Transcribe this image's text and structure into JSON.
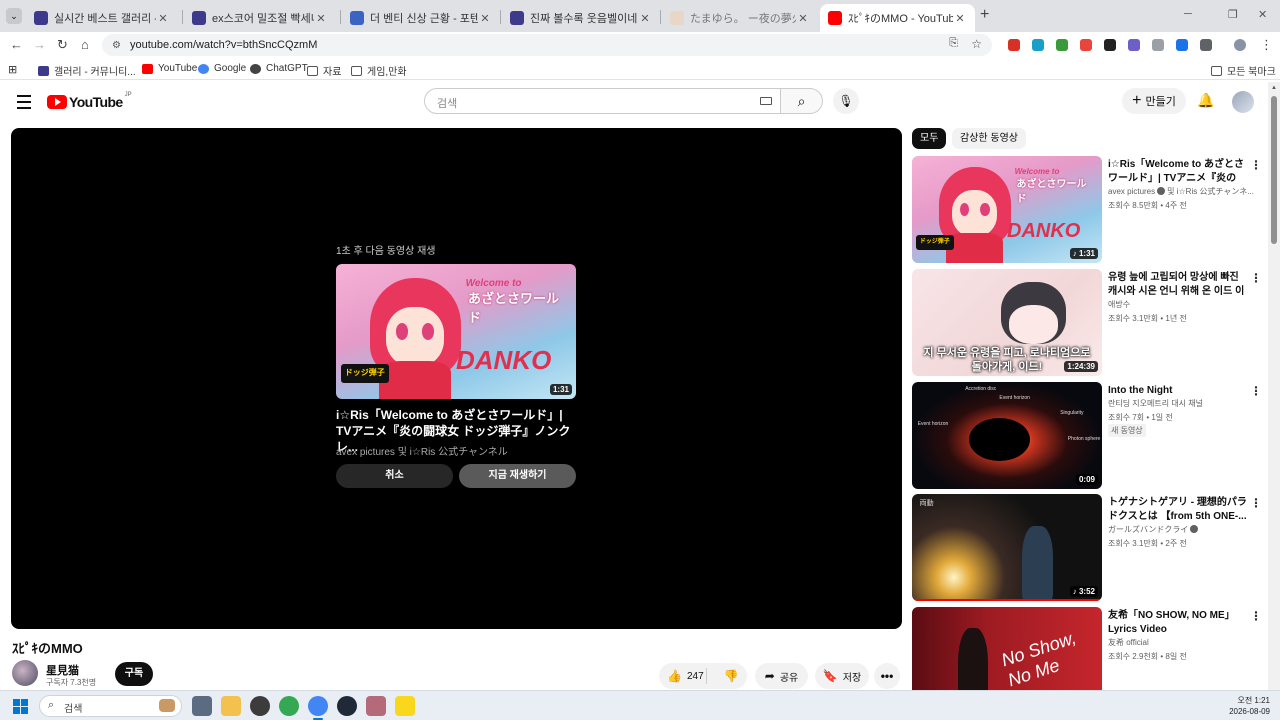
{
  "browser": {
    "tabs": [
      {
        "title": "실시간 베스트 갤러리 - 커뮤니",
        "color": "#3d3a8c"
      },
      {
        "title": "ex스코어 밀조절 빡세네 - 헤븐",
        "color": "#3d3a8c"
      },
      {
        "title": "더 벤티 신상 근황 - 포텐 터짐",
        "color": "#3a63c4"
      },
      {
        "title": "진짜 볼수록 웃음벨이네ㅋㅋㅋ",
        "color": "#3d3a8c"
      },
      {
        "title": "たまゆら。 ー夜の夢火 | スタジ",
        "color": "#e8d6c6"
      },
      {
        "title": "ｽﾋﾟｷのMMO - YouTube",
        "color": "#ff0000",
        "active": true
      }
    ],
    "url": "youtube.com/watch?v=bthSncCQzmM",
    "bookmarks": [
      {
        "label": "갤러리 - 커뮤니티...",
        "icon": "community-icon",
        "color": "#3d3a8c"
      },
      {
        "label": "YouTube",
        "icon": "youtube-icon",
        "color": "#ff0000"
      },
      {
        "label": "Google",
        "icon": "google-icon",
        "color": "#4285f4"
      },
      {
        "label": "ChatGPT",
        "icon": "chatgpt-icon",
        "color": "#444444"
      },
      {
        "label": "자료",
        "icon": "folder-icon",
        "color": "#555555"
      },
      {
        "label": "게임,만화",
        "icon": "folder-icon",
        "color": "#555555"
      }
    ],
    "all_bookmarks": "모든 북마크"
  },
  "youtube": {
    "logo_text": "YouTube",
    "region": "JP",
    "search_placeholder": "검색",
    "create_label": "만들기",
    "player": {
      "upnext_label": "1초 후 다음 동영상 재생",
      "upnext_title": "i☆Ris「Welcome to あざとさワールド」| TVアニメ『炎の闘球女 ドッジ弾子』ノンクレ...",
      "upnext_channel": "avex pictures 및 i☆Ris 公式チャンネル",
      "upnext_duration": "1:31",
      "cancel_label": "취소",
      "play_now_label": "지금 재생하기",
      "thumb_headline": "Welcome to",
      "thumb_kana": "あざとさワールド",
      "thumb_danko": "DANKO",
      "thumb_dodge": "ドッジ弾子"
    },
    "video": {
      "title": "ｽﾋﾟｷのMMO",
      "channel": "星見猫",
      "subscribers": "구독자 7.3천명",
      "subscribe_label": "구독",
      "likes": "247",
      "share_label": "공유",
      "save_label": "저장"
    },
    "chips": [
      "모두",
      "감상한 동영상"
    ],
    "recommendations": [
      {
        "title": "i☆Ris「Welcome to あざとさワールド」| TVアニメ『炎の闘...",
        "channel": "avex pictures",
        "channel_suffix": "및 i☆Ris 公式チャンネ...",
        "verified": true,
        "meta": "조회수 8.5만회 • 4주 전",
        "duration": "1:31",
        "shorts": true
      },
      {
        "title": "유령 늪에 고립되어 망상에 빠진 캐시와 시온 언니 위해 온 이드 이벤...",
        "channel": "애방수",
        "meta": "조회수 3.1만회 • 1년 전",
        "duration": "1:24:39",
        "caption": "지 무서운 유령을 피고, 로나티엄으로 돌아가게, 이드!"
      },
      {
        "title": "Into the Night",
        "channel": "란티딩 지오메트리 대시 채널",
        "meta": "조회수 7회 • 1일 전",
        "badge": "새 동영상",
        "duration": "0:09",
        "labels": [
          "Accretion disc",
          "Event horizon",
          "Singularity",
          "Photon sphere",
          "Event horizon"
        ]
      },
      {
        "title": "トゲナシトゲアリ - 理想的パラドクスとは 【from 5th ONE-...",
        "channel": "ガールズバンドクライ",
        "verified": true,
        "meta": "조회수 3.1만회 • 2주 전",
        "duration": "3:52",
        "shorts": true,
        "tag": "両動"
      },
      {
        "title": "友希「NO SHOW, NO ME」Lyrics Video",
        "channel": "友希 official",
        "meta": "조회수 2.9천회 • 8일 전",
        "script": "No Show, No Me"
      }
    ]
  },
  "taskbar": {
    "search_placeholder": "검색",
    "time": "오전 1:21",
    "date": "2026-08-09"
  }
}
